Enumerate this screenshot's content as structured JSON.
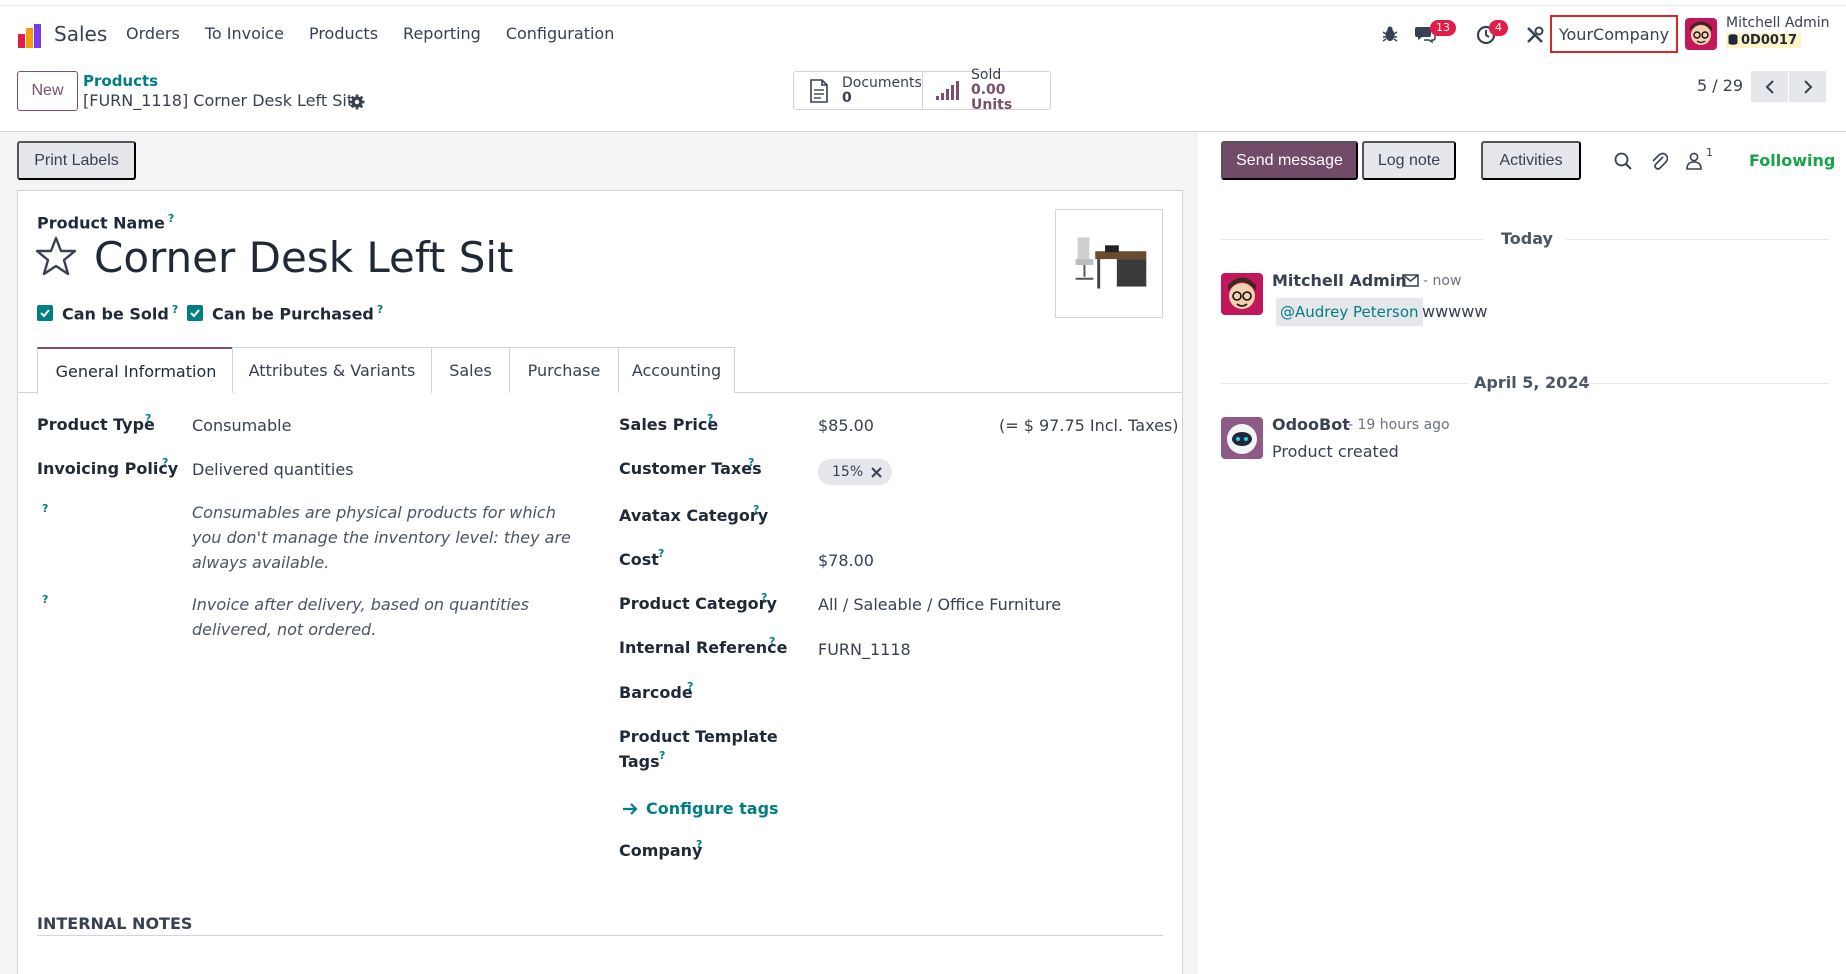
{
  "navbar": {
    "app_name": "Sales",
    "menu": [
      "Orders",
      "To Invoice",
      "Products",
      "Reporting",
      "Configuration"
    ],
    "messages_count": "13",
    "activities_count": "4",
    "company": "YourCompany",
    "user_name": "Mitchell Admin",
    "db_name": "0D0017"
  },
  "control": {
    "new_label": "New",
    "breadcrumb_parent": "Products",
    "breadcrumb_current": "[FURN_1118] Corner Desk Left Sit",
    "smart_buttons": [
      {
        "label": "Documents",
        "value": "0",
        "icon": "document-icon"
      },
      {
        "label": "Sold",
        "value": "0.00 Units",
        "icon": "signal-bars-icon"
      }
    ],
    "pager": "5 / 29"
  },
  "form": {
    "print_labels": "Print Labels",
    "product_name_label": "Product Name",
    "help_mark": "?",
    "product_name": "Corner Desk Left Sit",
    "can_be_sold": "Can be Sold",
    "can_be_purchased": "Can be Purchased",
    "can_be_sold_checked": true,
    "can_be_purchased_checked": true,
    "tabs": [
      "General Information",
      "Attributes & Variants",
      "Sales",
      "Purchase",
      "Accounting"
    ],
    "active_tab": "General Information",
    "left_fields": {
      "product_type_label": "Product Type",
      "product_type": "Consumable",
      "invoicing_policy_label": "Invoicing Policy",
      "invoicing_policy": "Delivered quantities",
      "product_type_help": "Consumables are physical products for which you don't manage the inventory level: they are always available.",
      "invoicing_help": "Invoice after delivery, based on quantities delivered, not ordered."
    },
    "right_fields": {
      "sales_price_label": "Sales Price",
      "sales_price": "$85.00",
      "incl_taxes": "(= $ 97.75 Incl. Taxes)",
      "customer_taxes_label": "Customer Taxes",
      "customer_tax_tag": "15%",
      "avatax_label": "Avatax Category",
      "cost_label": "Cost",
      "cost": "$78.00",
      "category_label": "Product Category",
      "category": "All / Saleable / Office Furniture",
      "internal_ref_label": "Internal Reference",
      "internal_ref": "FURN_1118",
      "barcode_label": "Barcode",
      "template_tags_label_1": "Product Template",
      "template_tags_label_2": "Tags",
      "configure_tags": "Configure tags",
      "company_label": "Company"
    },
    "internal_notes": "INTERNAL NOTES"
  },
  "chatter": {
    "send_message": "Send message",
    "log_note": "Log note",
    "activities": "Activities",
    "followers_count": "1",
    "following": "Following",
    "day1": "Today",
    "msg1_author": "Mitchell Admin",
    "msg1_date": "- now",
    "msg1_mention": "@Audrey Peterson",
    "msg1_body": "wwwww",
    "day2": "April 5, 2024",
    "msg2_author": "OdooBot",
    "msg2_date": "- 19 hours ago",
    "msg2_body": "Product created"
  },
  "colors": {
    "brand": "#714b67",
    "teal": "#017e84",
    "following": "#16a34a",
    "badge": "#e11d48",
    "highlight_border": "#dc2626"
  }
}
